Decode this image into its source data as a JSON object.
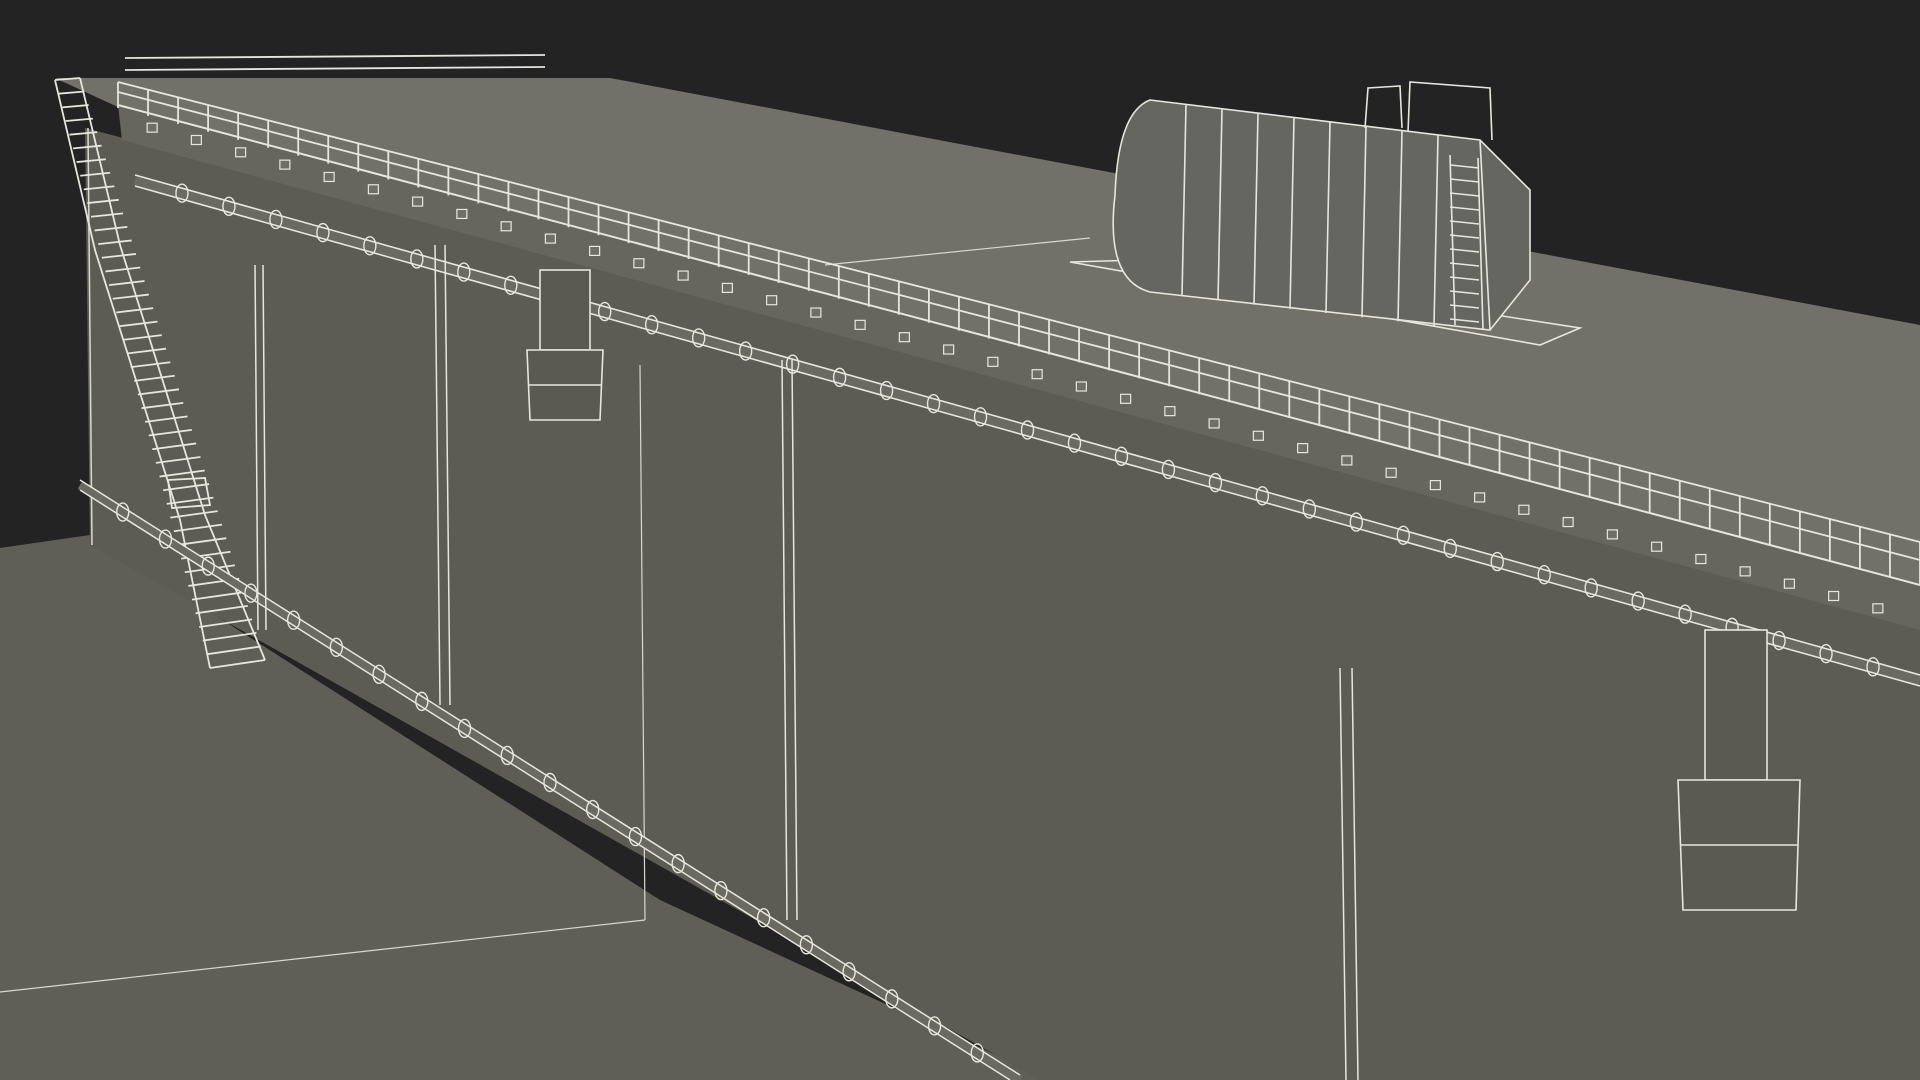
{
  "scene": {
    "subject": "wireframe-industrial-tank-wall",
    "colors": {
      "background": "#232323",
      "roof": "#717169",
      "wall": "#5c5c54",
      "wall_dark": "#55554e",
      "ground": "#5f5f58",
      "wire": "#e6e6dc",
      "wire_dim": "#cfcfc4"
    },
    "parts": [
      "roof-deck",
      "side-wall",
      "ground-plane",
      "roof-guardrail",
      "access-staircase",
      "horizontal-tank",
      "tank-skid",
      "top-pipe-run",
      "bottom-pipe-run",
      "vertical-pipes",
      "filter-housings",
      "wall-brackets"
    ]
  }
}
